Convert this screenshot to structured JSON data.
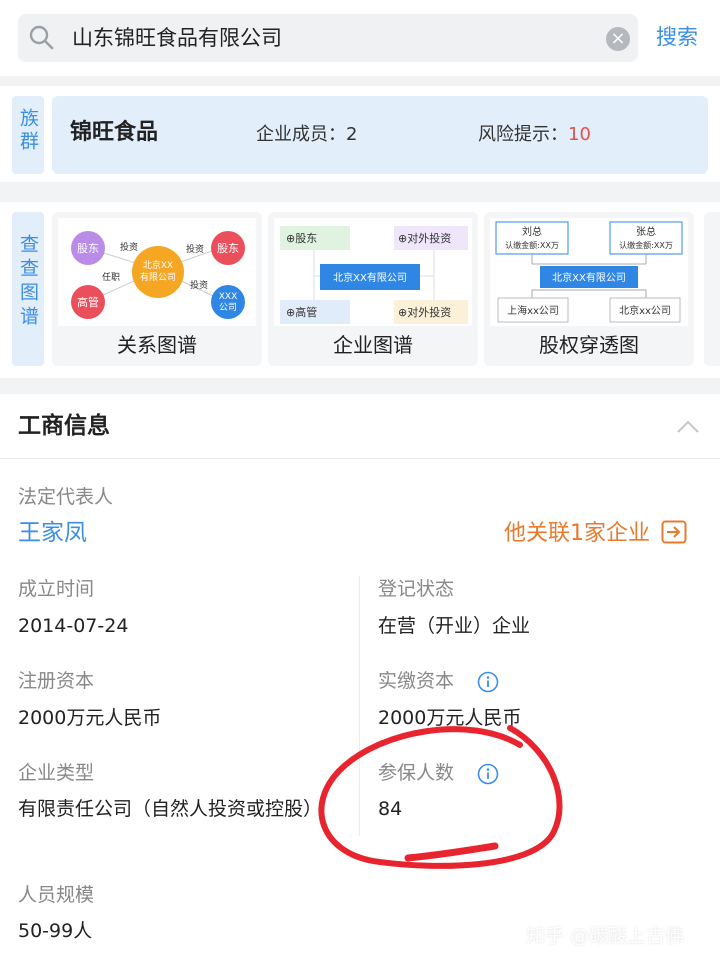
{
  "search": {
    "query": "山东锦旺食品有限公司",
    "button": "搜索"
  },
  "group": {
    "tab": "族群",
    "name": "锦旺食品",
    "members_label": "企业成员：",
    "members_count": "2",
    "risk_label": "风险提示：",
    "risk_count": "10"
  },
  "maps": {
    "tab": "查查图谱",
    "items": [
      {
        "label": "关系图谱",
        "nodes": {
          "shareholder": "股东",
          "company": "北京XX\n有限公司",
          "shareholder2": "股东",
          "exec": "高管",
          "company2": "XXX\n公司",
          "invest1": "投资",
          "invest2": "投资",
          "invest3": "投资",
          "role": "任职"
        }
      },
      {
        "label": "企业图谱",
        "nodes": {
          "shareholder": "股东",
          "invest_out": "对外投资",
          "company": "北京XX有限公司",
          "exec": "高管",
          "invest_out2": "对外投资"
        }
      },
      {
        "label": "股权穿透图",
        "nodes": {
          "person1": "刘总",
          "amount1": "认缴金额:XX万",
          "person2": "张总",
          "amount2": "认缴金额:XX万",
          "company": "北京XX有限公司",
          "sub1": "上海xx公司",
          "sub2": "北京xx公司"
        }
      }
    ]
  },
  "business": {
    "title": "工商信息",
    "legal_rep_label": "法定代表人",
    "legal_rep": "王家凤",
    "related": "他关联1家企业",
    "founded_label": "成立时间",
    "founded": "2014-07-24",
    "status_label": "登记状态",
    "status": "在营（开业）企业",
    "reg_capital_label": "注册资本",
    "reg_capital": "2000万元人民币",
    "paid_capital_label": "实缴资本",
    "paid_capital": "2000万元人民币",
    "type_label": "企业类型",
    "type": "有限责任公司（自然人投资或控股）",
    "insured_label": "参保人数",
    "insured": "84",
    "staff_label": "人员规模",
    "staff": "50-99人"
  },
  "watermark": "知乎 @碳酸上古佛",
  "colors": {
    "accent": "#3a8ee6",
    "risk": "#e0524d",
    "link_orange": "#e87a2e",
    "annotation": "#e8252f"
  }
}
